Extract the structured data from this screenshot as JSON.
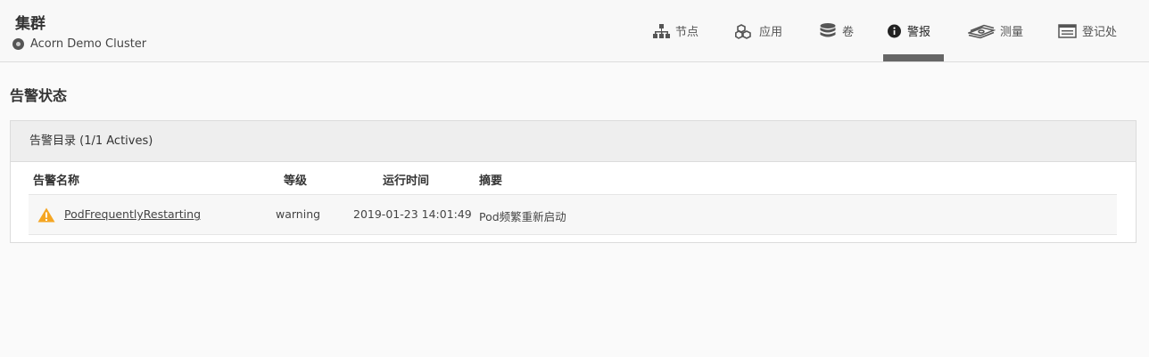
{
  "header": {
    "title": "集群",
    "cluster_name": "Acorn Demo Cluster"
  },
  "nav": {
    "items": [
      {
        "label": "节点",
        "icon": "sitemap-icon"
      },
      {
        "label": "应用",
        "icon": "cubes-icon"
      },
      {
        "label": "卷",
        "icon": "database-icon"
      },
      {
        "label": "警报",
        "icon": "info-circle-icon",
        "active": true
      },
      {
        "label": "测量",
        "icon": "money-stack-icon"
      },
      {
        "label": "登记处",
        "icon": "registry-icon"
      }
    ]
  },
  "main": {
    "section_title": "告警状态",
    "panel_title": "告警目录 (1/1 Actives)",
    "columns": [
      "告警名称",
      "等级",
      "运行时间",
      "摘要"
    ],
    "rows": [
      {
        "name": "PodFrequentlyRestarting",
        "level": "warning",
        "time": "2019-01-23 14:01:49",
        "summary": "Pod频繁重新启动"
      }
    ]
  },
  "colors": {
    "warning": "#f5a623",
    "active_underline": "#666666"
  }
}
